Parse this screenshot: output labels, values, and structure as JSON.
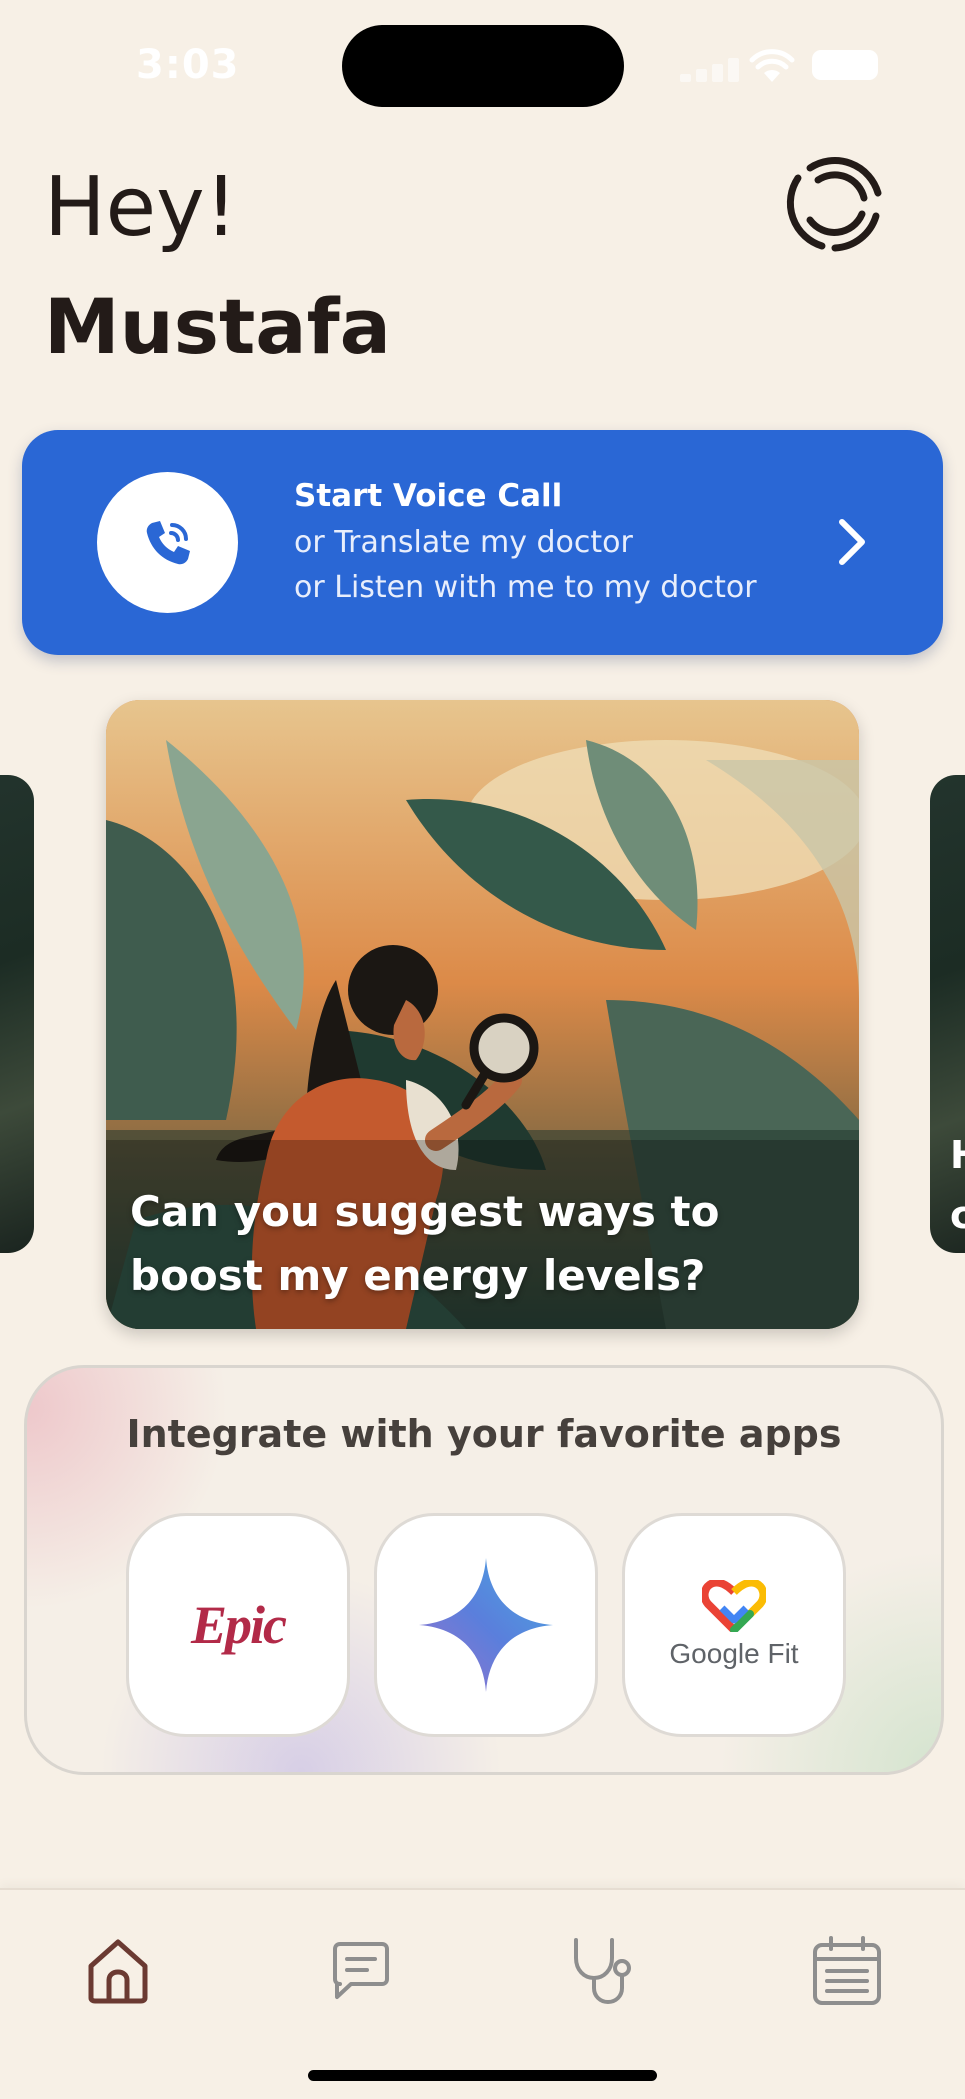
{
  "status_bar": {
    "time": "3:03"
  },
  "header": {
    "greeting": "Hey!",
    "user_name": "Mustafa"
  },
  "voice_call": {
    "title": "Start Voice Call",
    "subtitle_1": "or Translate my doctor",
    "subtitle_2": "or Listen with me to my doctor",
    "accent_color": "#2a67d5"
  },
  "carousel": {
    "main_card": {
      "caption": "Can you suggest ways to boost my energy levels?"
    },
    "next_card_peek": "H\nc"
  },
  "integrations": {
    "title": "Integrate with your favorite apps",
    "apps": [
      {
        "name": "Epic",
        "logo_text": "Epic"
      },
      {
        "name": "Gemini",
        "logo_text": ""
      },
      {
        "name": "Google Fit",
        "logo_text": "Google Fit"
      }
    ]
  },
  "bottom_nav": {
    "items": [
      {
        "icon": "home-icon"
      },
      {
        "icon": "chat-icon"
      },
      {
        "icon": "stethoscope-icon"
      },
      {
        "icon": "calendar-icon"
      }
    ]
  }
}
